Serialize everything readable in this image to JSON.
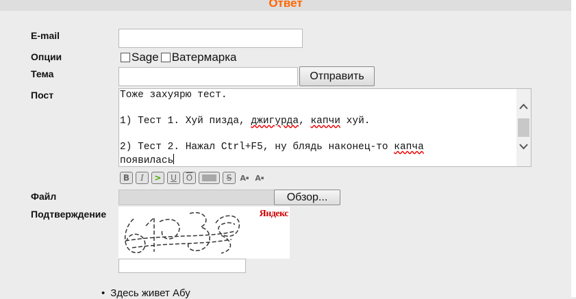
{
  "header": {
    "title": "Ответ"
  },
  "form": {
    "email_label": "E-mail",
    "email_value": "",
    "options_label": "Опции",
    "options": [
      {
        "label": "Sage",
        "checked": false
      },
      {
        "label": "Ватермарка",
        "checked": false
      }
    ],
    "subject_label": "Тема",
    "subject_value": "",
    "submit_label": "Отправить",
    "post_label": "Пост",
    "file_label": "Файл",
    "browse_label": "Обзор...",
    "captcha_label": "Подтверждение",
    "captcha_brand": "Яндекс",
    "captcha_input_value": ""
  },
  "post_text": {
    "line1": "Тоже захуярю тест.",
    "line2_a": "1) Тест 1. Хуй пизда, ",
    "line2_b": "джигурда",
    "line2_c": ", ",
    "line2_d": "капчи",
    "line2_e": " хуй.",
    "line3_a": "2) Тест 2. Нажал Ctrl+F5, ну блядь наконец-то ",
    "line3_b": "капча",
    "line4": "появилась"
  },
  "toolbar": {
    "buttons": [
      "B",
      "I",
      ">",
      "U",
      "O",
      "spoiler",
      "S",
      "A sup",
      "A sub"
    ]
  },
  "footer": {
    "items": [
      "Здесь живет Абу"
    ]
  }
}
